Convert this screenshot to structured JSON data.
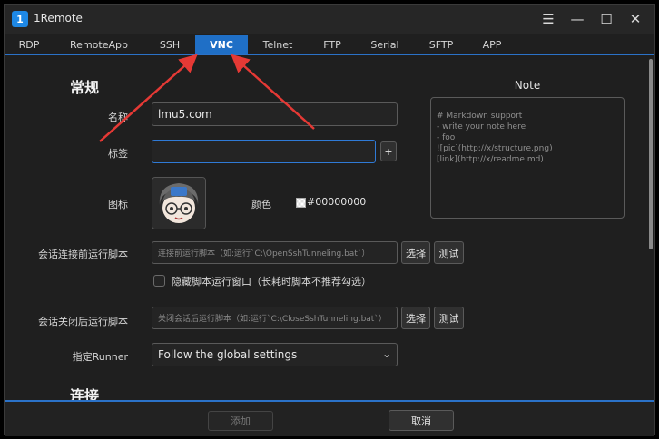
{
  "app": {
    "title": "1Remote",
    "logo_text": "1"
  },
  "window_controls": {
    "menu_icon": "hamburger-icon",
    "minimize_icon": "minimize-icon",
    "maximize_icon": "maximize-icon",
    "close_icon": "close-icon"
  },
  "tabs": [
    {
      "label": "RDP"
    },
    {
      "label": "RemoteApp"
    },
    {
      "label": "SSH"
    },
    {
      "label": "VNC",
      "active": true
    },
    {
      "label": "Telnet"
    },
    {
      "label": "FTP"
    },
    {
      "label": "Serial"
    },
    {
      "label": "SFTP"
    },
    {
      "label": "APP"
    }
  ],
  "general": {
    "section_title": "常规",
    "name_label": "名称",
    "name_value": "lmu5.com",
    "tag_label": "标签",
    "tag_value": "",
    "add_tag_label": "+",
    "icon_label": "图标",
    "color_label": "颜色",
    "color_value": "#00000000",
    "pre_script_label": "会话连接前运行脚本",
    "pre_script_placeholder": "连接前运行脚本（如:运行`C:\\OpenSshTunneling.bat`）",
    "select_label": "选择",
    "test_label": "测试",
    "hide_window_label": "隐藏脚本运行窗口（长耗时脚本不推荐勾选）",
    "post_script_label": "会话关闭后运行脚本",
    "post_script_placeholder": "关闭会话后运行脚本（如:运行`C:\\CloseSshTunneling.bat`）",
    "runner_label": "指定Runner",
    "runner_value": "Follow the global settings"
  },
  "connection": {
    "section_title": "连接"
  },
  "note": {
    "title": "Note",
    "lines": [
      "# Markdown support",
      "",
      "- write your note here",
      "- foo",
      "",
      "![pic](http://x/structure.png)",
      "",
      "[link](http://x/readme.md)"
    ]
  },
  "footer": {
    "add_label": "添加",
    "cancel_label": "取消"
  },
  "colors": {
    "accent": "#1f6fc6",
    "background": "#1f1f1f",
    "annotation_arrow": "#e53935"
  }
}
